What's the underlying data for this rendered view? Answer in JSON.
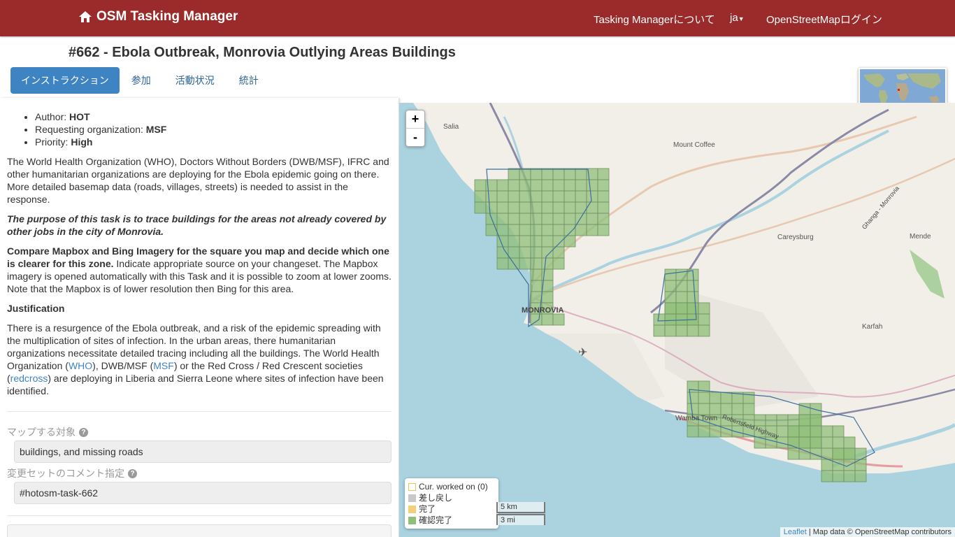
{
  "navbar": {
    "brand": "OSM Tasking Manager",
    "about": "Tasking Managerについて",
    "lang": "ja",
    "login": "OpenStreetMapログイン"
  },
  "project": {
    "title": "#662 - Ebola Outbreak, Monrovia Outlying Areas Buildings"
  },
  "tabs": [
    "インストラクション",
    "参加",
    "活動状況",
    "統計"
  ],
  "description": {
    "meta": [
      {
        "key": "Author:",
        "value": "HOT"
      },
      {
        "key": "Requesting organization:",
        "value": "MSF"
      },
      {
        "key": "Priority:",
        "value": "High"
      }
    ],
    "p1": "The World Health Organization (WHO), Doctors Without Borders (DWB/MSF), IFRC and other humanitarian organizations are deploying for the Ebola epidemic going on there. More detailed basemap data (roads, villages, streets) is needed to assist in the response.",
    "p2": "The purpose of this task is to trace buildings for the areas not already covered by other jobs in the city of Monrovia.",
    "p3_bold": "Compare Mapbox and Bing Imagery for the square you map and decide which one is clearer for this zone.",
    "p3_rest": " Indicate appropriate source on your changeset. The Mapbox imagery is opened automatically with this Task and it is possible to zoom at lower zooms. Note that the Mapbox is of lower resolution then Bing for this area.",
    "justification_heading": "Justification",
    "p4_a": "There is a resurgence of the Ebola outbreak, and a risk of the epidemic spreading with the multiplication of sites of infection. In the urban areas, there humanitarian organizations necessitate detailed tracing including all the buildings. The World Health Organization (",
    "link_who": "WHO",
    "p4_b": "), DWB/MSF (",
    "link_msf": "MSF",
    "p4_c": ") or the Red Cross / Red Crescent societies (",
    "link_redcross": "redcross",
    "p4_d": ") are deploying in Liberia and Sierra Leone where sites of infection have been identified."
  },
  "fields": {
    "entities_label": "マップする対象",
    "entities_value": "buildings, and missing roads",
    "changeset_label": "変更セットのコメント指定",
    "changeset_value": "#hotosm-task-662"
  },
  "map": {
    "zoom_in": "+",
    "zoom_out": "-",
    "places": [
      "Salia",
      "Mount Coffee",
      "MONROVIA",
      "Careysburg",
      "Mende",
      "Karfah",
      "Wamba Town",
      "Robertsfield Highway",
      "Ghanga - Monrovia"
    ],
    "legend": [
      {
        "label": "Cur. worked on (0)",
        "color": "#fff",
        "border": "#f0c060"
      },
      {
        "label": "差し戻し",
        "color": "#c8c8c8",
        "border": "#c8c8c8"
      },
      {
        "label": "完了",
        "color": "#f3cf7a",
        "border": "#f3cf7a"
      },
      {
        "label": "確認完了",
        "color": "#8fbf78",
        "border": "#8fbf78"
      }
    ],
    "scale_km": "5 km",
    "scale_mi": "3 mi",
    "attribution_link": "Leaflet",
    "attribution_text": " | Map data © OpenStreetMap contributors"
  },
  "colors": {
    "navbar": "#9b2a2a",
    "tab_active": "#3f84c2",
    "sea": "#aad3df",
    "validated": "#8fbf78"
  }
}
